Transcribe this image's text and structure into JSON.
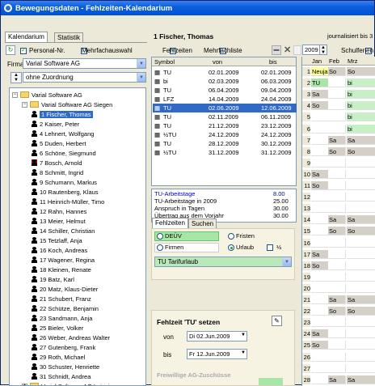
{
  "window": {
    "title": "Bewegungsdaten - Fehlzeiten-Kalendarium"
  },
  "left": {
    "tabs": [
      {
        "label": "Kalendarium"
      },
      {
        "label": "Statistik"
      }
    ],
    "personal_nr_label": "Personal-Nr.",
    "mehrfachauswahl_label": "Mehrfachauswahl",
    "firma_label": "Firma",
    "firma_value": "Varial Software AG",
    "zuordnung_value": "ohne Zuordnung",
    "tree": [
      {
        "label": "Varial Software AG",
        "level": 0,
        "kind": "folder-root"
      },
      {
        "label": "Varial Software AG Siegen",
        "level": 1,
        "kind": "folder"
      },
      {
        "label": "1 Fischer, Thomas",
        "level": 2,
        "kind": "person",
        "selected": true
      },
      {
        "label": "2 Kaiser, Peter",
        "level": 2,
        "kind": "person"
      },
      {
        "label": "4 Lehnert, Wolfgang",
        "level": 2,
        "kind": "person"
      },
      {
        "label": "5 Duden, Herbert",
        "level": 2,
        "kind": "person"
      },
      {
        "label": "6 Schöne, Siegmund",
        "level": 2,
        "kind": "person"
      },
      {
        "label": "7 Bosch, Arnold",
        "level": 2,
        "kind": "person-red"
      },
      {
        "label": "8 Schmitt, Ingrid",
        "level": 2,
        "kind": "person"
      },
      {
        "label": "9 Schumann, Markus",
        "level": 2,
        "kind": "person"
      },
      {
        "label": "10 Rautenberg, Klaus",
        "level": 2,
        "kind": "person"
      },
      {
        "label": "11 Heinrich-Müller, Timo",
        "level": 2,
        "kind": "person"
      },
      {
        "label": "12 Rahn, Hannes",
        "level": 2,
        "kind": "person"
      },
      {
        "label": "13 Meier, Helmut",
        "level": 2,
        "kind": "person"
      },
      {
        "label": "14 Schiller, Christian",
        "level": 2,
        "kind": "person"
      },
      {
        "label": "15 Tetzlaff, Anja",
        "level": 2,
        "kind": "person"
      },
      {
        "label": "16 Koch, Andreas",
        "level": 2,
        "kind": "person"
      },
      {
        "label": "17 Wagener, Regina",
        "level": 2,
        "kind": "person"
      },
      {
        "label": "18 Kleinen, Renate",
        "level": 2,
        "kind": "person"
      },
      {
        "label": "19 Batz, Karl",
        "level": 2,
        "kind": "person"
      },
      {
        "label": "20 Matz, Klaus-Dieter",
        "level": 2,
        "kind": "person"
      },
      {
        "label": "21 Schubert, Franz",
        "level": 2,
        "kind": "person"
      },
      {
        "label": "22 Schütze, Benjamin",
        "level": 2,
        "kind": "person"
      },
      {
        "label": "23 Sandmann, Anja",
        "level": 2,
        "kind": "person"
      },
      {
        "label": "25 Bieler, Volker",
        "level": 2,
        "kind": "person"
      },
      {
        "label": "26 Weber, Andreas Walter",
        "level": 2,
        "kind": "person"
      },
      {
        "label": "27 Gutenberg, Frank",
        "level": 2,
        "kind": "person"
      },
      {
        "label": "29 Roth, Michael",
        "level": 2,
        "kind": "person"
      },
      {
        "label": "30 Schuster, Henriette",
        "level": 2,
        "kind": "person"
      },
      {
        "label": "31 Schnidt, Andrea",
        "level": 2,
        "kind": "person"
      },
      {
        "label": "Varial Software AG Leipzig",
        "level": 1,
        "kind": "folder-collapsed"
      }
    ]
  },
  "middle": {
    "person_name": "1 Fischer, Thomas",
    "fehlzeiten_label": "Fehlzeiten",
    "mehrfachliste_label": "Mehrfachliste",
    "columns": {
      "symbol": "Symbol",
      "von": "von",
      "bis": "bis"
    },
    "rows": [
      {
        "symbol": "TU",
        "von": "02.01.2009",
        "bis": "02.01.2009"
      },
      {
        "symbol": "bi",
        "von": "02.03.2009",
        "bis": "06.03.2009"
      },
      {
        "symbol": "TU",
        "von": "06.04.2009",
        "bis": "09.04.2009"
      },
      {
        "symbol": "LFZ",
        "von": "14.04.2009",
        "bis": "24.04.2009"
      },
      {
        "symbol": "TU",
        "von": "02.06.2009",
        "bis": "12.06.2009",
        "selected": true
      },
      {
        "symbol": "TU",
        "von": "02.11.2009",
        "bis": "06.11.2009"
      },
      {
        "symbol": "TU",
        "von": "21.12.2009",
        "bis": "23.12.2009"
      },
      {
        "symbol": "½TU",
        "von": "24.12.2009",
        "bis": "24.12.2009"
      },
      {
        "symbol": "TU",
        "von": "28.12.2009",
        "bis": "30.12.2009"
      },
      {
        "symbol": "½TU",
        "von": "31.12.2009",
        "bis": "31.12.2009"
      }
    ],
    "summary": [
      {
        "label": "TU-Arbeitstage",
        "value": "8.00",
        "color": "#0000cc"
      },
      {
        "label": "TU-Arbeitstage in 2009",
        "value": "25.00",
        "color": "#000000"
      },
      {
        "label": "Anspruch in Tagen",
        "value": "30.00",
        "color": "#000000"
      },
      {
        "label": "Übertrag aus dem Vorjahr",
        "value": "30.00",
        "color": "#000000"
      }
    ],
    "tabs": [
      {
        "label": "Fehlzeiten"
      },
      {
        "label": "Suchen"
      }
    ],
    "options": {
      "deuev": "DEÜV",
      "fristen": "Fristen",
      "firmen": "Firmen",
      "urlaub": "Urlaub",
      "half": "½"
    },
    "type_value": "TU Tarifurlaub",
    "set_title": "Fehlzeit 'TU' setzen",
    "von_label": "von",
    "von_value": "Di 02.Jun.2009",
    "bis_label": "bis",
    "bis_value": "Fr 12.Jun.2009",
    "freiwillig_label": "Freiwillige AG-Zuschüsse"
  },
  "right": {
    "journalisiert": "journalisiert bis 3",
    "year": "2009",
    "schulferien_label": "Schulferien",
    "months": [
      "Jan",
      "Feb",
      "Mrz"
    ],
    "days": [
      {
        "n": "1",
        "c1": "Neujahr",
        "c2": "So",
        "c3": "So"
      },
      {
        "n": "2",
        "c1": "TU",
        "c2": "",
        "c3": "bi"
      },
      {
        "n": "3",
        "c1": "Sa",
        "c2": "",
        "c3": "bi"
      },
      {
        "n": "4",
        "c1": "So",
        "c2": "",
        "c3": "bi"
      },
      {
        "n": "5",
        "c1": "",
        "c2": "",
        "c3": "bi"
      },
      {
        "n": "6",
        "c1": "",
        "c2": "",
        "c3": "bi"
      },
      {
        "n": "7",
        "c1": "",
        "c2": "Sa",
        "c3": "Sa"
      },
      {
        "n": "8",
        "c1": "",
        "c2": "So",
        "c3": "So"
      },
      {
        "n": "9",
        "c1": "",
        "c2": "",
        "c3": ""
      },
      {
        "n": "10",
        "c1": "Sa",
        "c2": "",
        "c3": ""
      },
      {
        "n": "11",
        "c1": "So",
        "c2": "",
        "c3": ""
      },
      {
        "n": "12",
        "c1": "",
        "c2": "",
        "c3": ""
      },
      {
        "n": "13",
        "c1": "",
        "c2": "",
        "c3": ""
      },
      {
        "n": "14",
        "c1": "",
        "c2": "Sa",
        "c3": "Sa"
      },
      {
        "n": "15",
        "c1": "",
        "c2": "So",
        "c3": "So"
      },
      {
        "n": "16",
        "c1": "",
        "c2": "",
        "c3": ""
      },
      {
        "n": "17",
        "c1": "Sa",
        "c2": "",
        "c3": ""
      },
      {
        "n": "18",
        "c1": "So",
        "c2": "",
        "c3": ""
      },
      {
        "n": "19",
        "c1": "",
        "c2": "",
        "c3": ""
      },
      {
        "n": "20",
        "c1": "",
        "c2": "",
        "c3": ""
      },
      {
        "n": "21",
        "c1": "",
        "c2": "Sa",
        "c3": "Sa"
      },
      {
        "n": "22",
        "c1": "",
        "c2": "So",
        "c3": "So"
      },
      {
        "n": "23",
        "c1": "",
        "c2": "",
        "c3": ""
      },
      {
        "n": "24",
        "c1": "Sa",
        "c2": "",
        "c3": ""
      },
      {
        "n": "25",
        "c1": "So",
        "c2": "",
        "c3": ""
      },
      {
        "n": "26",
        "c1": "",
        "c2": "",
        "c3": ""
      },
      {
        "n": "27",
        "c1": "",
        "c2": "",
        "c3": ""
      },
      {
        "n": "28",
        "c1": "",
        "c2": "Sa",
        "c3": "Sa"
      }
    ]
  },
  "colors": {
    "title_blue": "#0053d6",
    "selection": "#316ac5",
    "weekend": "#d4d0c8",
    "holiday": "#ffff99",
    "tu": "#a8e6a8",
    "bi": "#c7f0c7"
  }
}
